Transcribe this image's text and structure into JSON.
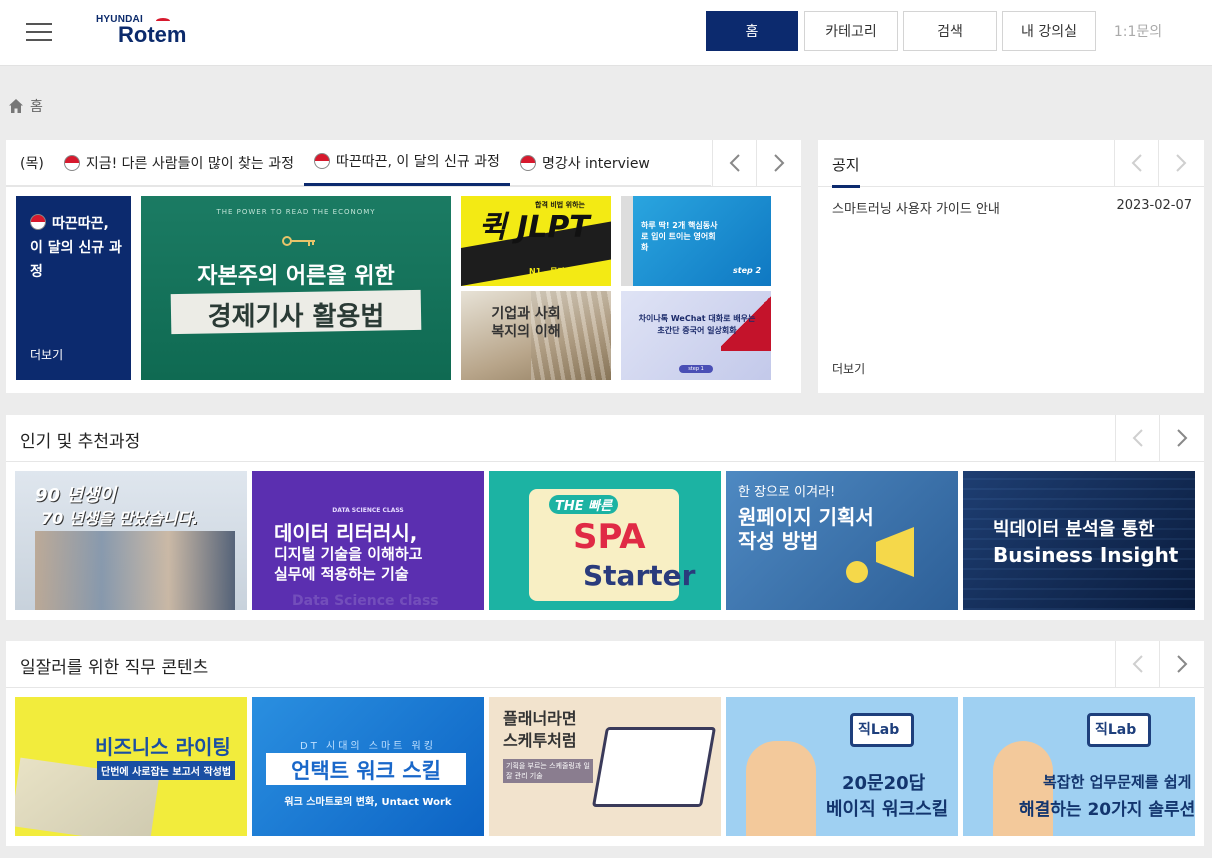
{
  "brand": {
    "top": "HYUNDAI",
    "name": "Rotem"
  },
  "nav": {
    "home": "홈",
    "category": "카테고리",
    "search": "검색",
    "my_room": "내 강의실",
    "inquiry": "1:1문의"
  },
  "breadcrumb": {
    "home": "홈"
  },
  "featured": {
    "tabs": [
      "(목)",
      "지금! 다른 사람들이 많이 찾는 과정",
      "따끈따끈, 이 달의 신규 과정",
      "명강사 interview"
    ],
    "card_title": "따끈따끈, 이 달의 신규 과정",
    "more": "더보기",
    "big_tile": {
      "tag": "THE POWER TO READ THE ECONOMY",
      "line1": "자본주의 어른을 위한",
      "line2": "경제기사 활용법"
    },
    "small_tiles": [
      {
        "title": "퀵 JLPT",
        "sub": "N1 - 문자어휘",
        "tag": "합격 비법 위하는"
      },
      {
        "title": "하루 딱! 2개 핵심동사로 입이 트이는 영어회화",
        "sub": "step 2"
      },
      {
        "title": "기업과 사회복지의 이해"
      },
      {
        "title": "차이나톡 WeChat 대화로 배우는 초간단 중국어 일상회화",
        "sub": "step 1"
      }
    ]
  },
  "notice": {
    "title": "공지",
    "items": [
      {
        "text": "스마트러닝 사용자 가이드 안내",
        "date": "2023-02-07"
      }
    ],
    "more": "더보기"
  },
  "popular": {
    "title": "인기 및 추천과정",
    "tiles": [
      {
        "line1": "90 년생이",
        "line2": "70 년생을 만났습니다."
      },
      {
        "tag": "DATA SCIENCE CLASS",
        "line1": "데이터 리터러시,",
        "line2": "디지털 기술을 이해하고",
        "line3": "실무에 적용하는 기술",
        "bg": "Data Science class"
      },
      {
        "line1": "THE 빠른",
        "line2": "SPA",
        "line3": "Starter"
      },
      {
        "tag": "한 장으로 이겨라!",
        "line1": "원페이지 기획서",
        "line2": "작성 방법"
      },
      {
        "line1": "빅데이터 분석을 통한",
        "line2": "Business Insight"
      }
    ]
  },
  "jobs": {
    "title": "일잘러를 위한 직무 콘텐츠",
    "tiles": [
      {
        "line1": "비즈니스 라이팅",
        "line2": "단번에 사로잡는 보고서 작성법"
      },
      {
        "tag": "DT 시대의 스마트 워킹",
        "line1": "언택트 워크 스킬",
        "line2": "워크 스마트로의 변화, Untact Work"
      },
      {
        "line1": "플래너라면",
        "line2": "스케투처럼",
        "line3": "기획을 부르는 스케줄링과 일 잘 관리 기술"
      },
      {
        "badge": "직Lab",
        "line1": "20문20답",
        "line2": "베이직 워크스킬"
      },
      {
        "badge": "직Lab",
        "line1": "복잡한 업무문제를 쉽게",
        "line2": "해결하는 20가지 솔루션"
      }
    ]
  },
  "colors": {
    "navy": "#0c2a6e",
    "brand_red": "#d7192d"
  }
}
